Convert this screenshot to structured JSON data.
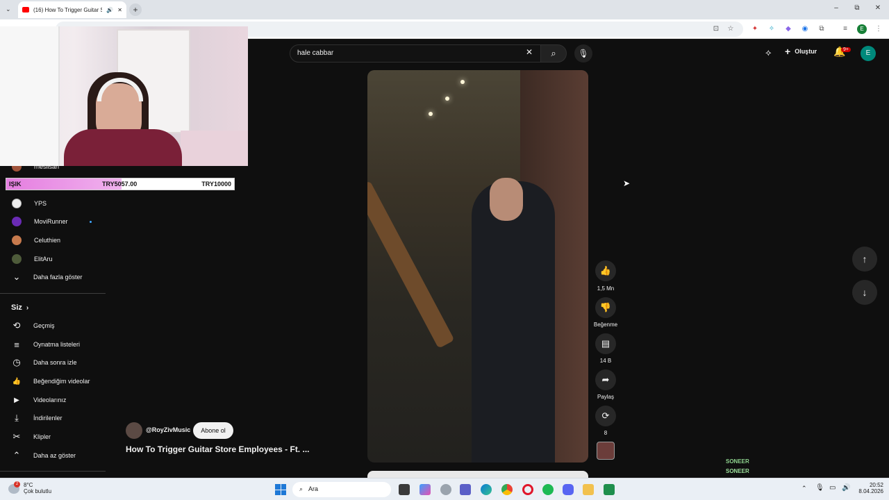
{
  "browser": {
    "tab_title": "(16) How To Trigger Guitar S",
    "new_tab": "+",
    "minimize": "–",
    "restore": "⧉",
    "close": "✕",
    "profile_initial": "E"
  },
  "donation": {
    "name": "IŞIK",
    "current": "TRY5057.00",
    "goal": "TRY10000",
    "progress": 0.5057
  },
  "sidebar": {
    "sub_partial": "rhesilsan",
    "subs": [
      {
        "label": "YPS",
        "color": "#eeeeee"
      },
      {
        "label": "MoviRunner",
        "color": "#6a2bb5",
        "dot": true
      },
      {
        "label": "Celuthien",
        "color": "#c77a4d"
      },
      {
        "label": "ElitAru",
        "color": "#4e5b3a"
      }
    ],
    "show_more": "Daha fazla göster",
    "you_header": "Siz",
    "you_items": [
      {
        "icon": "⟲",
        "label": "Geçmiş"
      },
      {
        "icon": "≡",
        "label": "Oynatma listeleri"
      },
      {
        "icon": "◷",
        "label": "Daha sonra izle"
      },
      {
        "icon": "👍",
        "label": "Beğendiğim videolar"
      },
      {
        "icon": "▶",
        "label": "Videolarınız"
      },
      {
        "icon": "⤓",
        "label": "İndirilenler"
      },
      {
        "icon": "✂",
        "label": "Klipler"
      }
    ],
    "show_less": "Daha az göster"
  },
  "search": {
    "query": "hale cabbar",
    "clear": "✕",
    "search_icon": "⌕",
    "mic_icon": "🎙"
  },
  "header": {
    "create_label": "Oluştur",
    "notif_badge": "9+",
    "avatar_initial": "E"
  },
  "actions": {
    "like_count": "1,5 Mn",
    "dislike_label": "Beğenme",
    "comment_count": "14 B",
    "share_label": "Paylaş",
    "remix_count": "8"
  },
  "video": {
    "channel": "@RoyZivMusic",
    "subscribe_label": "Abone ol",
    "title": "How To Trigger Guitar Store Employees - Ft. ..."
  },
  "chat": [
    {
      "user": "SONEER",
      "color": "#8fd48f"
    },
    {
      "user": "SONEER",
      "color": "#9ee29e"
    }
  ],
  "taskbar": {
    "weather_temp": "8°C",
    "weather_desc": "Çok bulutlu",
    "weather_badge": "2",
    "search_label": "Ara",
    "time": "20:52",
    "date": "8.04.2026"
  }
}
